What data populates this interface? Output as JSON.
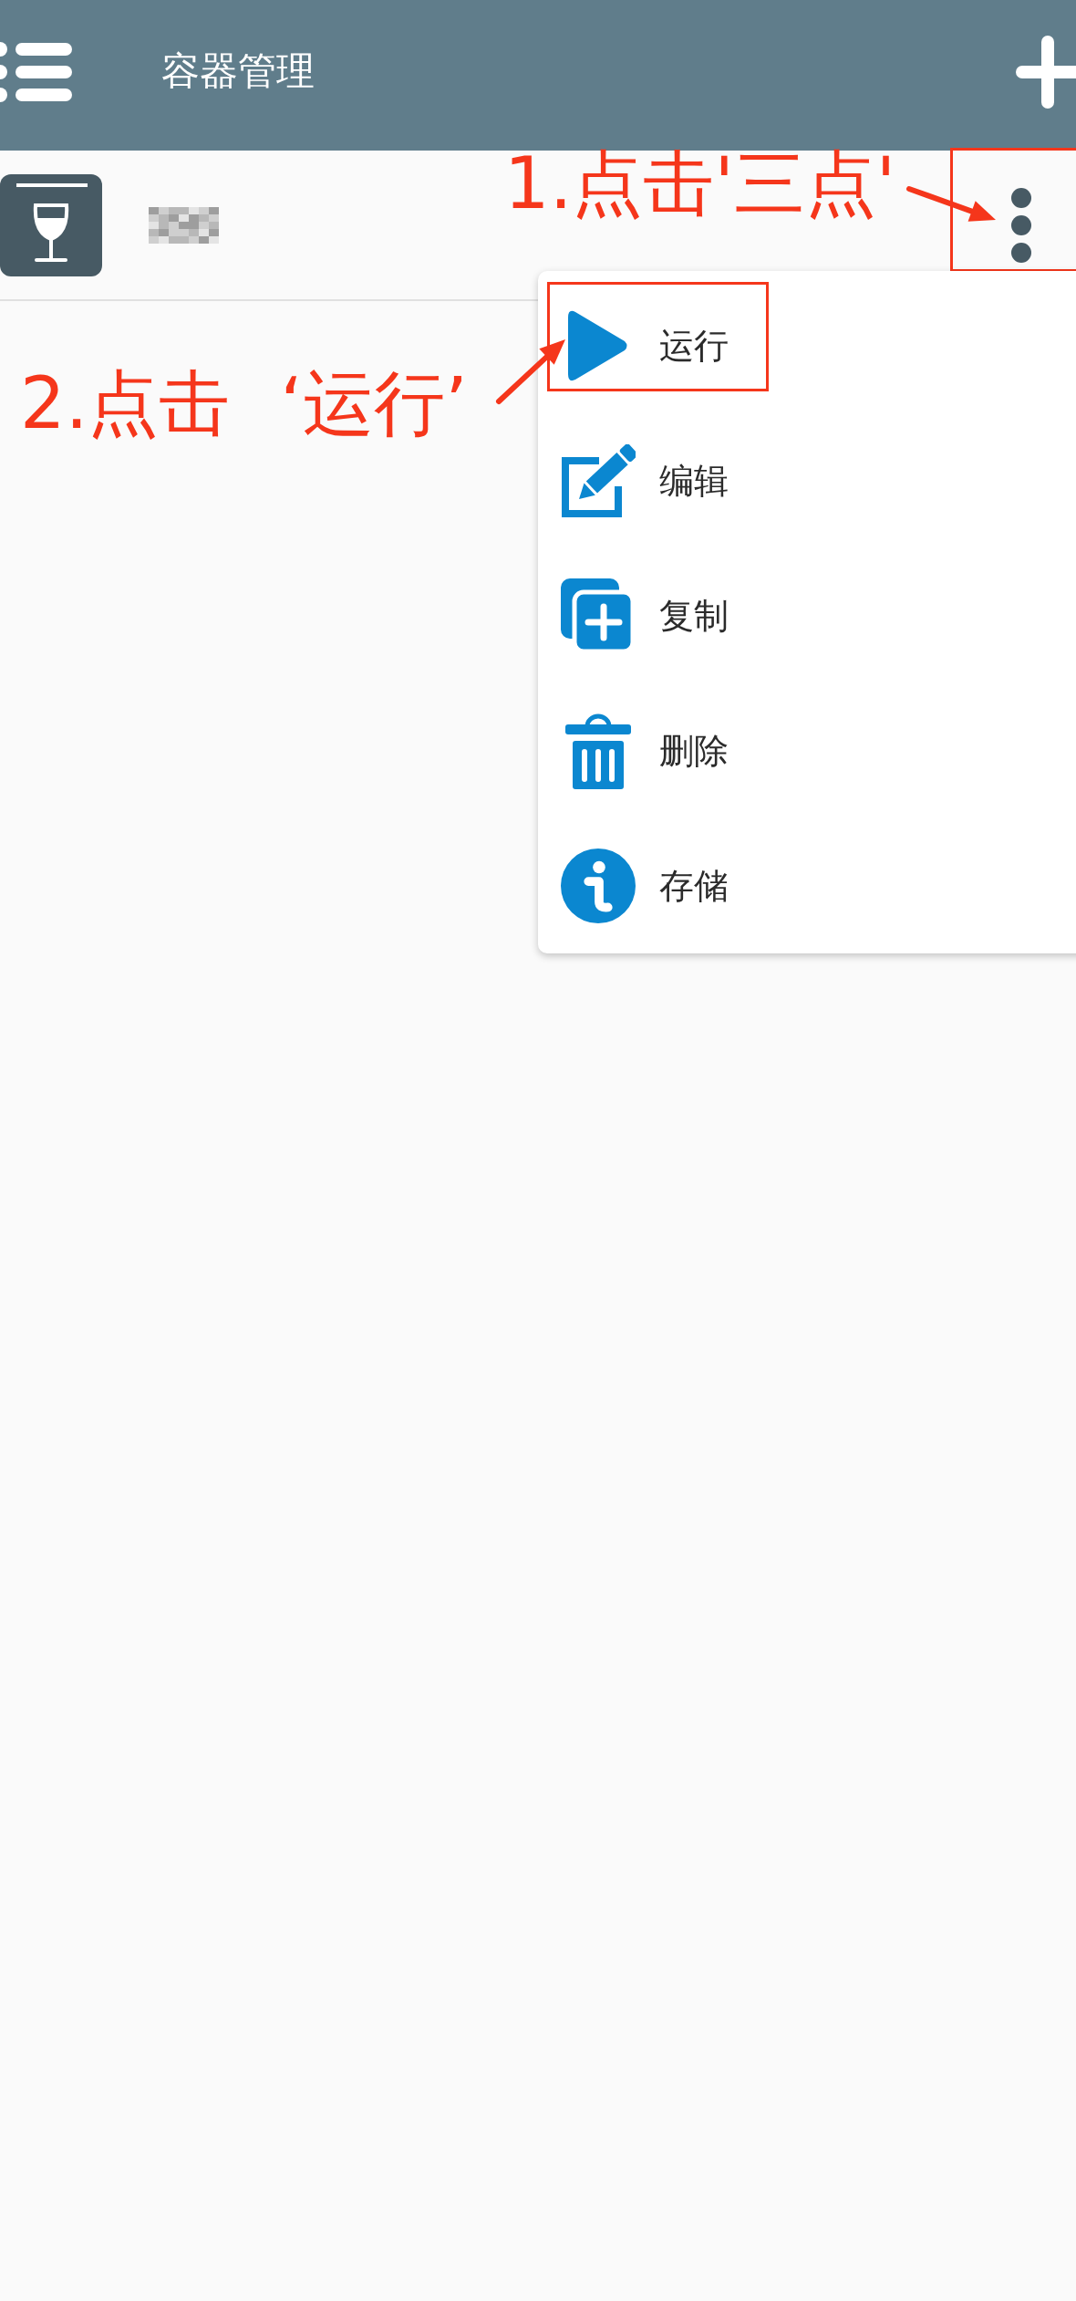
{
  "app_bar": {
    "title": "容器管理"
  },
  "container_row": {
    "more_button": {
      "highlighted": true
    }
  },
  "menu": {
    "items": [
      {
        "label": "运行",
        "highlighted": true
      },
      {
        "label": "编辑",
        "highlighted": false
      },
      {
        "label": "复制",
        "highlighted": false
      },
      {
        "label": "删除",
        "highlighted": false
      },
      {
        "label": "存储",
        "highlighted": false
      }
    ]
  },
  "annotations": [
    {
      "text": "1.点击'三点'"
    },
    {
      "text": "2.点击 ‘运行’"
    }
  ]
}
